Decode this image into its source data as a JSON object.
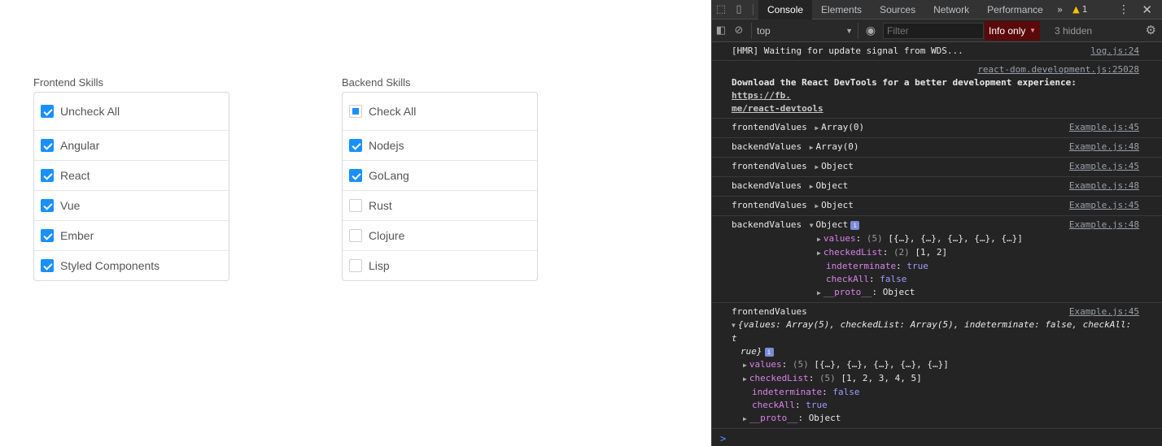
{
  "app": {
    "frontend": {
      "title": "Frontend Skills",
      "master": {
        "label": "Uncheck All",
        "state": "checked"
      },
      "items": [
        {
          "label": "Angular",
          "checked": true
        },
        {
          "label": "React",
          "checked": true
        },
        {
          "label": "Vue",
          "checked": true
        },
        {
          "label": "Ember",
          "checked": true
        },
        {
          "label": "Styled Components",
          "checked": true
        }
      ]
    },
    "backend": {
      "title": "Backend Skills",
      "master": {
        "label": "Check All",
        "state": "indeterminate"
      },
      "items": [
        {
          "label": "Nodejs",
          "checked": true
        },
        {
          "label": "GoLang",
          "checked": true
        },
        {
          "label": "Rust",
          "checked": false
        },
        {
          "label": "Clojure",
          "checked": false
        },
        {
          "label": "Lisp",
          "checked": false
        }
      ]
    },
    "accent_color": "#1890ff"
  },
  "devtools": {
    "tabs": [
      "Console",
      "Elements",
      "Sources",
      "Network",
      "Performance"
    ],
    "active_tab": "Console",
    "more_tabs": "»",
    "warning_count": "1",
    "context": "top",
    "filter_placeholder": "Filter",
    "levels_label": "Info only",
    "hidden_label": "3 hidden",
    "messages": {
      "hmr": {
        "text": "[HMR] Waiting for update signal from WDS...",
        "src": "log.js:24"
      },
      "react_devtools": {
        "src": "react-dom.development.js:25028",
        "text": "Download the React DevTools for a better development experience: ",
        "link": "https://fb.me/react-devtools",
        "link_line1": "https://fb.",
        "link_line2": "me/react-devtools"
      },
      "m1": {
        "name": "frontendValues",
        "value": "Array(0)",
        "src": "Example.js:45"
      },
      "m2": {
        "name": "backendValues",
        "value": "Array(0)",
        "src": "Example.js:48"
      },
      "m3": {
        "name": "frontendValues",
        "value": "Object",
        "src": "Example.js:45"
      },
      "m4": {
        "name": "backendValues",
        "value": "Object",
        "src": "Example.js:48"
      },
      "m5": {
        "name": "frontendValues",
        "value": "Object",
        "src": "Example.js:45"
      },
      "m6": {
        "name": "backendValues",
        "value": "Object",
        "src": "Example.js:48",
        "props": {
          "values_key": "values",
          "values_count": "(5)",
          "values_val": "[{…}, {…}, {…}, {…}, {…}]",
          "checked_key": "checkedList",
          "checked_count": "(2)",
          "checked_val": "[1, 2]",
          "indet_key": "indeterminate",
          "indet_val": "true",
          "checkall_key": "checkAll",
          "checkall_val": "false",
          "proto_key": "__proto__",
          "proto_val": "Object"
        }
      },
      "m7": {
        "name": "frontendValues",
        "src": "Example.js:45",
        "summary_1": "{values: Array(5), checkedList: Array(5), indeterminate: false, checkAll: t",
        "summary_2": "rue}",
        "props": {
          "values_key": "values",
          "values_count": "(5)",
          "values_val": "[{…}, {…}, {…}, {…}, {…}]",
          "checked_key": "checkedList",
          "checked_count": "(5)",
          "checked_val": "[1, 2, 3, 4, 5]",
          "indet_key": "indeterminate",
          "indet_val": "false",
          "checkall_key": "checkAll",
          "checkall_val": "true",
          "proto_key": "__proto__",
          "proto_val": "Object"
        }
      }
    },
    "prompt": ">"
  }
}
